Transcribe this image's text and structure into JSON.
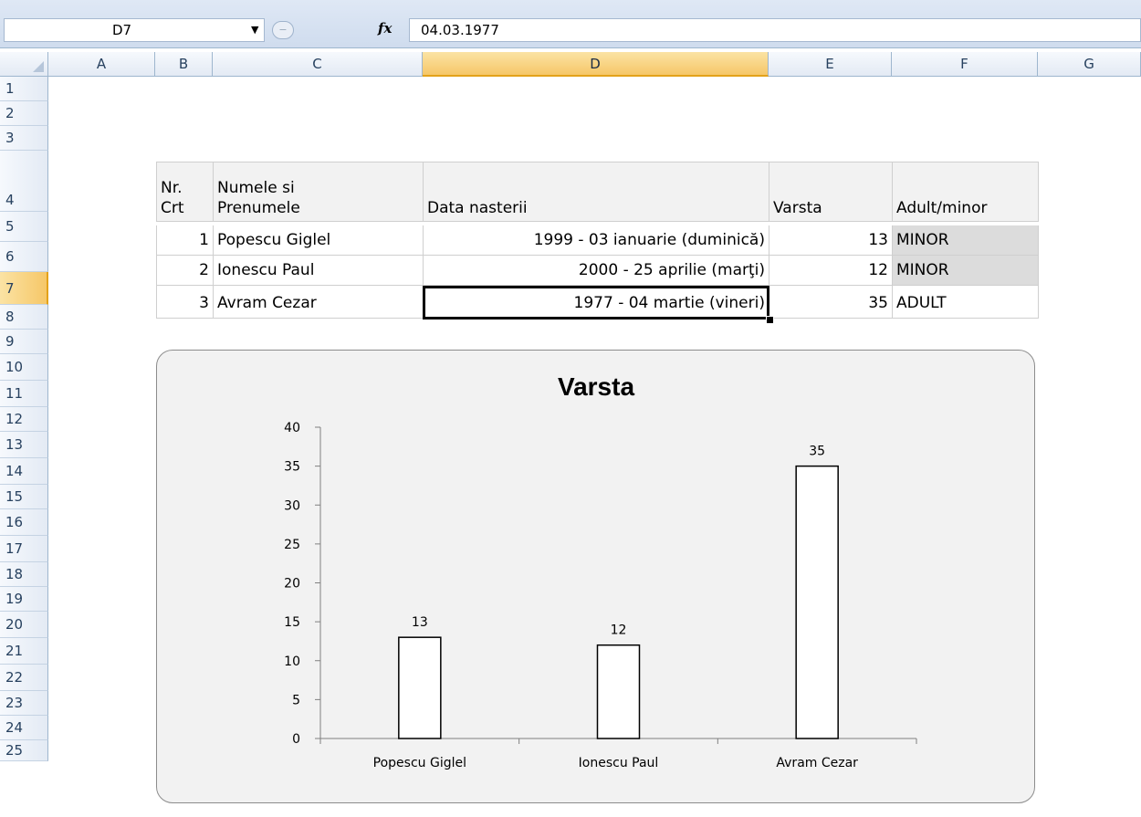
{
  "formula_bar": {
    "name_box": "D7",
    "name_box_arrow": "▼",
    "fx_label": "fx",
    "formula": "04.03.1977"
  },
  "columns": [
    "A",
    "B",
    "C",
    "D",
    "E",
    "F",
    "G"
  ],
  "selected_column": "D",
  "rows": [
    "1",
    "2",
    "3",
    "4",
    "5",
    "6",
    "7",
    "8",
    "9",
    "10",
    "11",
    "12",
    "13",
    "14",
    "15",
    "16",
    "17",
    "18",
    "19",
    "20",
    "21",
    "22",
    "23",
    "24",
    "25"
  ],
  "selected_row": "7",
  "table": {
    "headers": {
      "nr": [
        "Nr.",
        "Crt"
      ],
      "name": [
        "Numele si",
        "Prenumele"
      ],
      "date": "Data nasterii",
      "age": "Varsta",
      "status": "Adult/minor"
    },
    "rows": [
      {
        "nr": "1",
        "name": "Popescu Giglel",
        "date": "1999 - 03 ianuarie (duminică)",
        "age": "13",
        "status": "MINOR"
      },
      {
        "nr": "2",
        "name": "Ionescu Paul",
        "date": "2000 - 25 aprilie (marţi)",
        "age": "12",
        "status": "MINOR"
      },
      {
        "nr": "3",
        "name": "Avram Cezar",
        "date": "1977 - 04 martie (vineri)",
        "age": "35",
        "status": "ADULT"
      }
    ]
  },
  "chart_data": {
    "type": "bar",
    "title": "Varsta",
    "categories": [
      "Popescu Giglel",
      "Ionescu Paul",
      "Avram Cezar"
    ],
    "values": [
      13,
      12,
      35
    ],
    "data_labels": [
      "13",
      "12",
      "35"
    ],
    "ylim": [
      0,
      40
    ],
    "yticks": [
      0,
      5,
      10,
      15,
      20,
      25,
      30,
      35,
      40
    ],
    "xlabel": "",
    "ylabel": "",
    "grid": false,
    "legend": "none",
    "bar_fill": "#ffffff",
    "bar_stroke": "#000000"
  }
}
